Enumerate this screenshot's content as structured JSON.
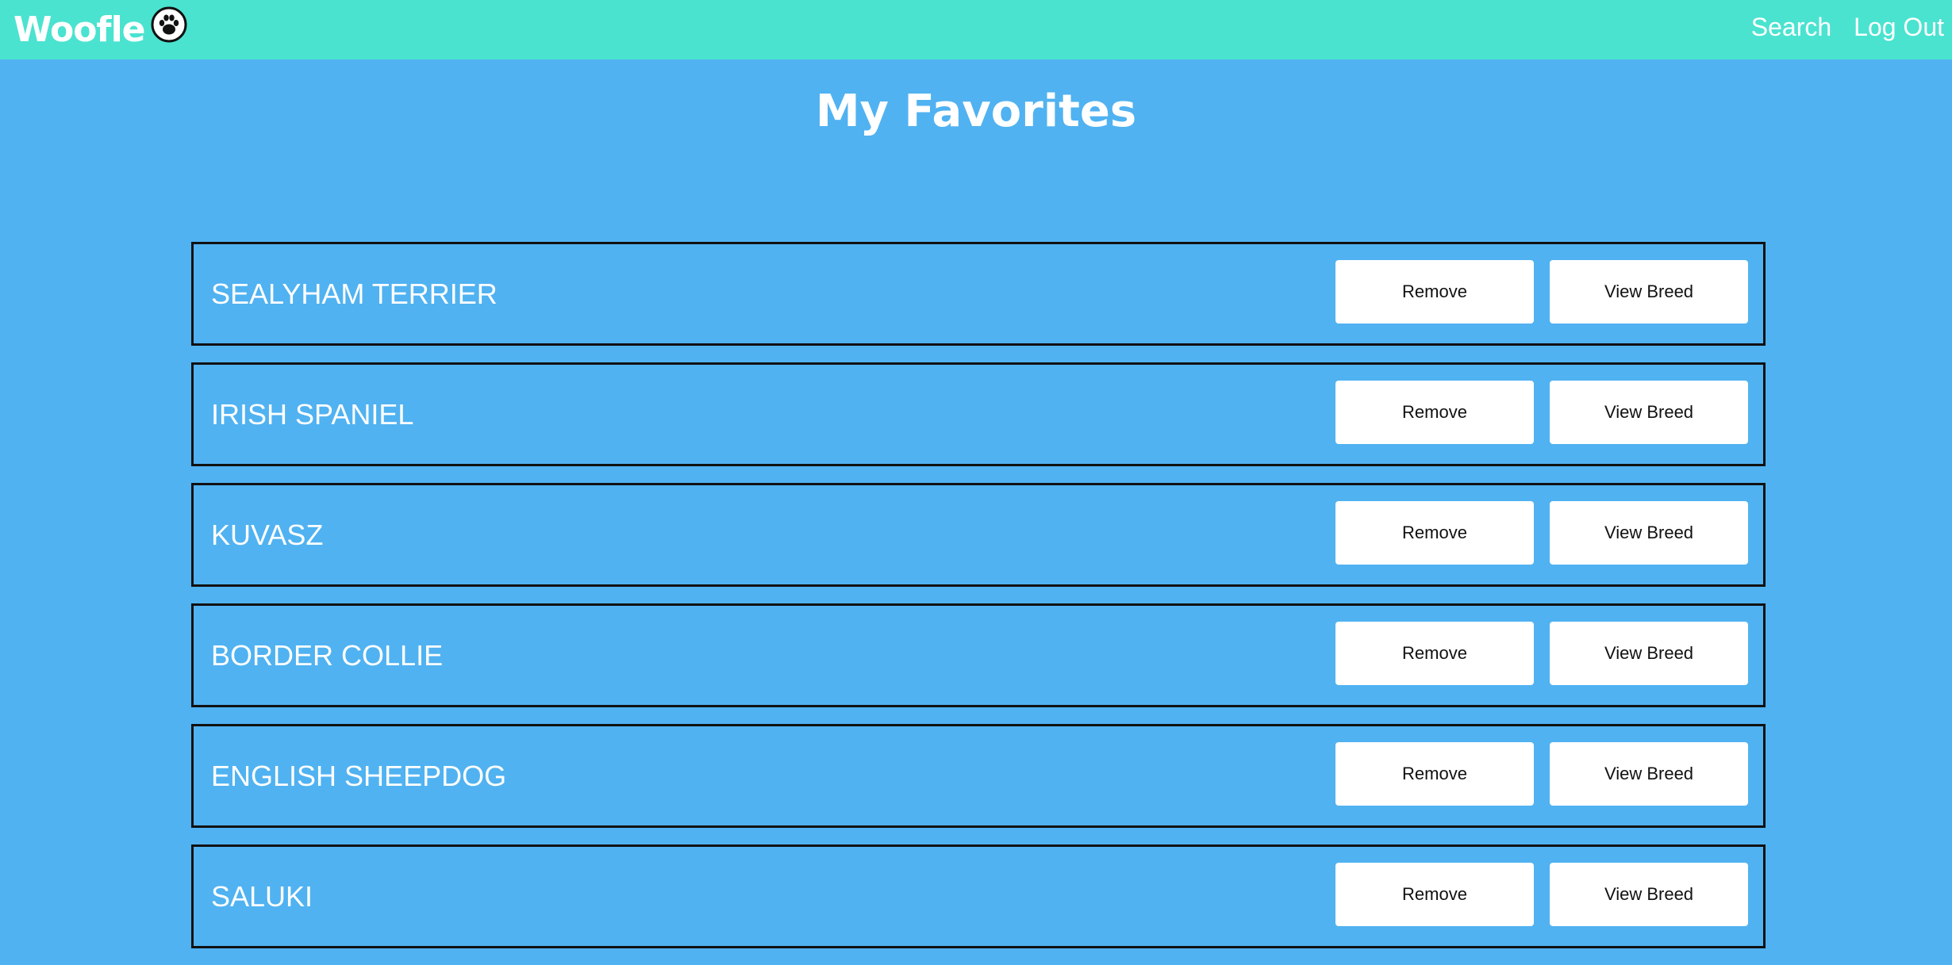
{
  "app": {
    "brand": "Woofle",
    "brand_icon": "paw-icon"
  },
  "nav": {
    "search_label": "Search",
    "logout_label": "Log Out"
  },
  "page": {
    "title": "My Favorites"
  },
  "favorites": [
    {
      "breed": "SEALYHAM TERRIER",
      "remove_label": "Remove",
      "view_label": "View Breed"
    },
    {
      "breed": "IRISH SPANIEL",
      "remove_label": "Remove",
      "view_label": "View Breed"
    },
    {
      "breed": "KUVASZ",
      "remove_label": "Remove",
      "view_label": "View Breed"
    },
    {
      "breed": "BORDER COLLIE",
      "remove_label": "Remove",
      "view_label": "View Breed"
    },
    {
      "breed": "ENGLISH SHEEPDOG",
      "remove_label": "Remove",
      "view_label": "View Breed"
    },
    {
      "breed": "SALUKI",
      "remove_label": "Remove",
      "view_label": "View Breed"
    }
  ],
  "colors": {
    "navbar": "#4ae3d0",
    "background": "#50b2f1",
    "row_border": "#111111",
    "button_bg": "#ffffff"
  }
}
